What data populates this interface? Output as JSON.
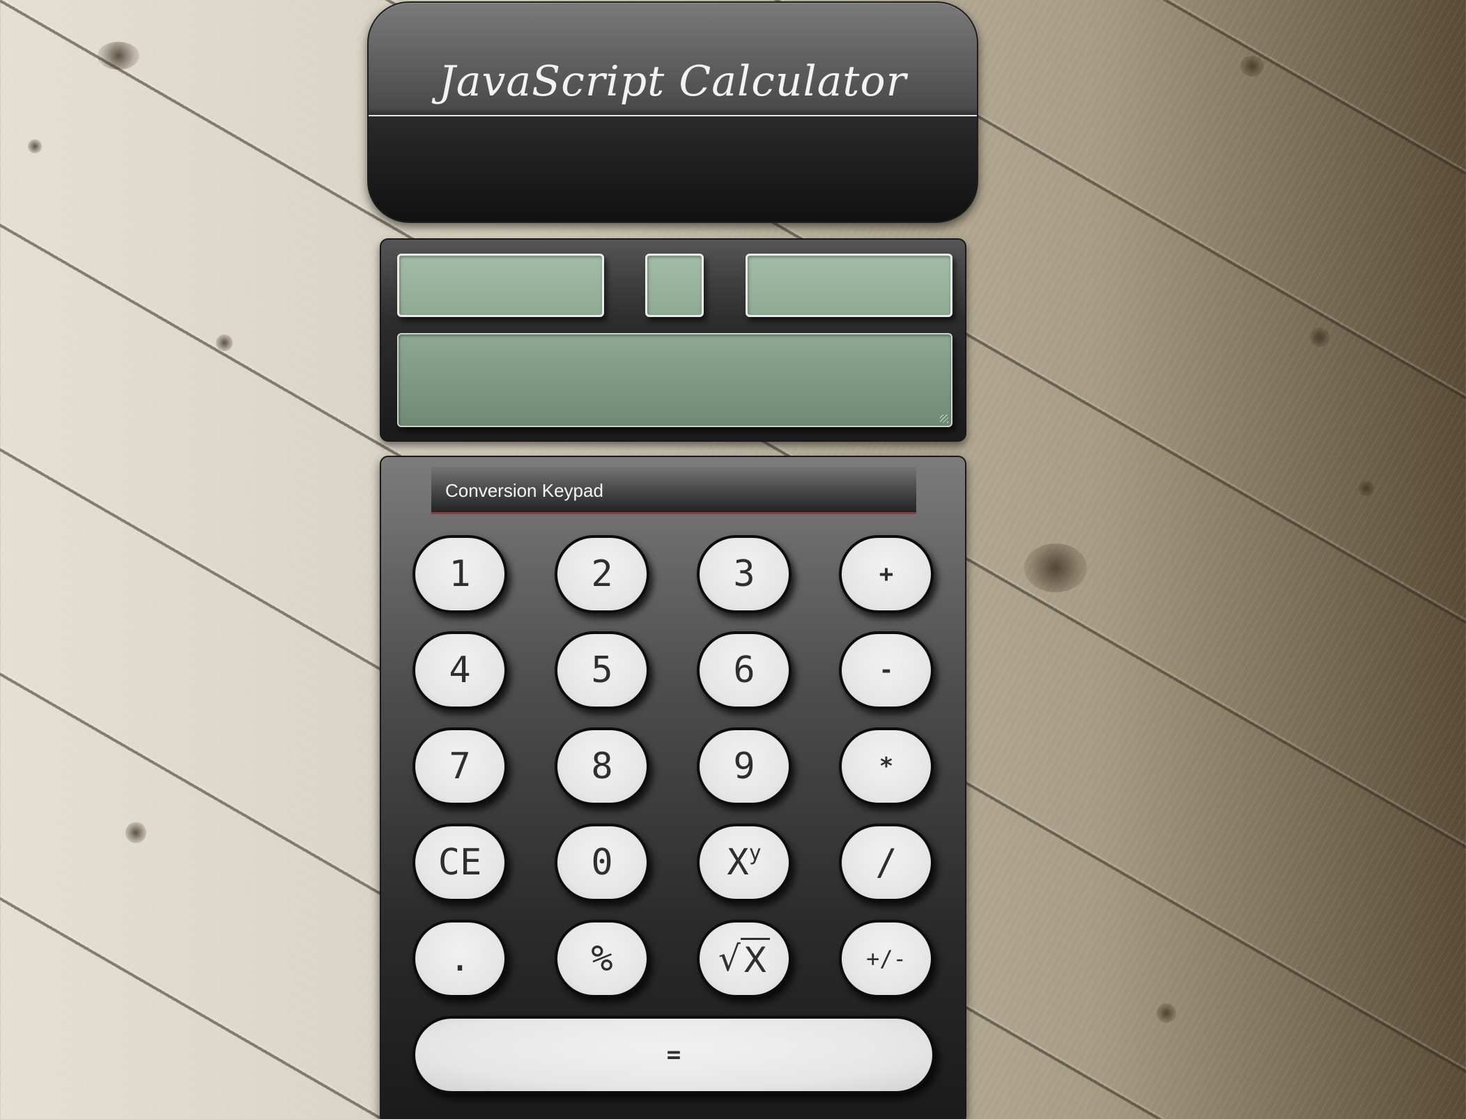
{
  "header": {
    "title": "JavaScript Calculator"
  },
  "display": {
    "operand_a": "",
    "operator": "",
    "operand_b": "",
    "result": ""
  },
  "keypad": {
    "tab_label": "Conversion Keypad",
    "keys": {
      "k1": "1",
      "k2": "2",
      "k3": "3",
      "plus": "+",
      "k4": "4",
      "k5": "5",
      "k6": "6",
      "minus": "-",
      "k7": "7",
      "k8": "8",
      "k9": "9",
      "multiply": "*",
      "clear": "CE",
      "k0": "0",
      "power_base": "X",
      "power_exp": "y",
      "divide": "/",
      "decimal": ".",
      "percent": "%",
      "sqrt_symbol": "√",
      "sqrt_arg": "X",
      "negate": "+/-",
      "equals": "="
    }
  },
  "colors": {
    "lcd_green": "#9ab6a0",
    "panel_dark": "#1a1a1a",
    "key_face": "#e6e6e6",
    "tab_underline": "#8a3b3b"
  }
}
